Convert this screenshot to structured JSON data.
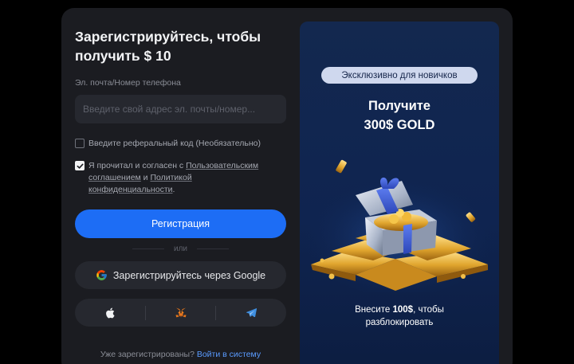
{
  "signup": {
    "title": "Зарегистрируйтесь, чтобы получить $ 10",
    "email_label": "Эл. почта/Номер телефона",
    "email_placeholder": "Введите свой адрес эл. почты/номер...",
    "email_value": "",
    "referral_label": "Введите реферальный код (Необязательно)",
    "referral_checked": false,
    "terms_checked": true,
    "terms_prefix": "Я прочитал и согласен с ",
    "terms_link1": "Пользовательским соглашением",
    "terms_and": " и ",
    "terms_link2": "Политикой конфиденциальности",
    "terms_suffix": ".",
    "register_button": "Регистрация",
    "or_text": "или",
    "google_button": "Зарегистрируйтесь через Google",
    "social_icons": [
      "apple-icon",
      "metamask-icon",
      "telegram-icon"
    ],
    "already_registered": "Уже зарегистрированы?",
    "login_link": "Войти в систему"
  },
  "promo": {
    "badge": "Эксклюзивно для новичков",
    "title_line1": "Получите",
    "title_line2": "300$ GOLD",
    "footer_prefix": "Внесите ",
    "footer_amount": "100$",
    "footer_suffix": ", чтобы",
    "footer_line2": "разблокировать"
  },
  "colors": {
    "accent": "#1d6df5",
    "link": "#5a9bff",
    "panel": "#1b1c21",
    "promo_bg": "#0f2450"
  }
}
